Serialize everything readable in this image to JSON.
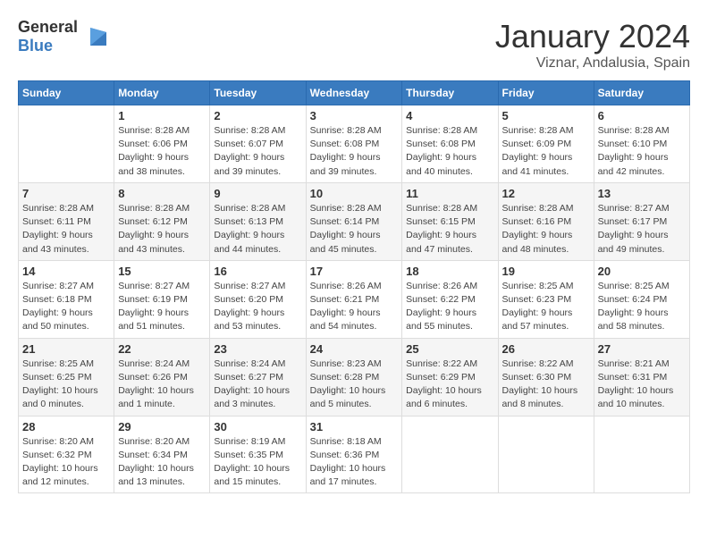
{
  "header": {
    "logo_general": "General",
    "logo_blue": "Blue",
    "month": "January 2024",
    "location": "Viznar, Andalusia, Spain"
  },
  "days_of_week": [
    "Sunday",
    "Monday",
    "Tuesday",
    "Wednesday",
    "Thursday",
    "Friday",
    "Saturday"
  ],
  "weeks": [
    [
      {
        "day": "",
        "info": ""
      },
      {
        "day": "1",
        "info": "Sunrise: 8:28 AM\nSunset: 6:06 PM\nDaylight: 9 hours\nand 38 minutes."
      },
      {
        "day": "2",
        "info": "Sunrise: 8:28 AM\nSunset: 6:07 PM\nDaylight: 9 hours\nand 39 minutes."
      },
      {
        "day": "3",
        "info": "Sunrise: 8:28 AM\nSunset: 6:08 PM\nDaylight: 9 hours\nand 39 minutes."
      },
      {
        "day": "4",
        "info": "Sunrise: 8:28 AM\nSunset: 6:08 PM\nDaylight: 9 hours\nand 40 minutes."
      },
      {
        "day": "5",
        "info": "Sunrise: 8:28 AM\nSunset: 6:09 PM\nDaylight: 9 hours\nand 41 minutes."
      },
      {
        "day": "6",
        "info": "Sunrise: 8:28 AM\nSunset: 6:10 PM\nDaylight: 9 hours\nand 42 minutes."
      }
    ],
    [
      {
        "day": "7",
        "info": "Sunrise: 8:28 AM\nSunset: 6:11 PM\nDaylight: 9 hours\nand 43 minutes."
      },
      {
        "day": "8",
        "info": "Sunrise: 8:28 AM\nSunset: 6:12 PM\nDaylight: 9 hours\nand 43 minutes."
      },
      {
        "day": "9",
        "info": "Sunrise: 8:28 AM\nSunset: 6:13 PM\nDaylight: 9 hours\nand 44 minutes."
      },
      {
        "day": "10",
        "info": "Sunrise: 8:28 AM\nSunset: 6:14 PM\nDaylight: 9 hours\nand 45 minutes."
      },
      {
        "day": "11",
        "info": "Sunrise: 8:28 AM\nSunset: 6:15 PM\nDaylight: 9 hours\nand 47 minutes."
      },
      {
        "day": "12",
        "info": "Sunrise: 8:28 AM\nSunset: 6:16 PM\nDaylight: 9 hours\nand 48 minutes."
      },
      {
        "day": "13",
        "info": "Sunrise: 8:27 AM\nSunset: 6:17 PM\nDaylight: 9 hours\nand 49 minutes."
      }
    ],
    [
      {
        "day": "14",
        "info": "Sunrise: 8:27 AM\nSunset: 6:18 PM\nDaylight: 9 hours\nand 50 minutes."
      },
      {
        "day": "15",
        "info": "Sunrise: 8:27 AM\nSunset: 6:19 PM\nDaylight: 9 hours\nand 51 minutes."
      },
      {
        "day": "16",
        "info": "Sunrise: 8:27 AM\nSunset: 6:20 PM\nDaylight: 9 hours\nand 53 minutes."
      },
      {
        "day": "17",
        "info": "Sunrise: 8:26 AM\nSunset: 6:21 PM\nDaylight: 9 hours\nand 54 minutes."
      },
      {
        "day": "18",
        "info": "Sunrise: 8:26 AM\nSunset: 6:22 PM\nDaylight: 9 hours\nand 55 minutes."
      },
      {
        "day": "19",
        "info": "Sunrise: 8:25 AM\nSunset: 6:23 PM\nDaylight: 9 hours\nand 57 minutes."
      },
      {
        "day": "20",
        "info": "Sunrise: 8:25 AM\nSunset: 6:24 PM\nDaylight: 9 hours\nand 58 minutes."
      }
    ],
    [
      {
        "day": "21",
        "info": "Sunrise: 8:25 AM\nSunset: 6:25 PM\nDaylight: 10 hours\nand 0 minutes."
      },
      {
        "day": "22",
        "info": "Sunrise: 8:24 AM\nSunset: 6:26 PM\nDaylight: 10 hours\nand 1 minute."
      },
      {
        "day": "23",
        "info": "Sunrise: 8:24 AM\nSunset: 6:27 PM\nDaylight: 10 hours\nand 3 minutes."
      },
      {
        "day": "24",
        "info": "Sunrise: 8:23 AM\nSunset: 6:28 PM\nDaylight: 10 hours\nand 5 minutes."
      },
      {
        "day": "25",
        "info": "Sunrise: 8:22 AM\nSunset: 6:29 PM\nDaylight: 10 hours\nand 6 minutes."
      },
      {
        "day": "26",
        "info": "Sunrise: 8:22 AM\nSunset: 6:30 PM\nDaylight: 10 hours\nand 8 minutes."
      },
      {
        "day": "27",
        "info": "Sunrise: 8:21 AM\nSunset: 6:31 PM\nDaylight: 10 hours\nand 10 minutes."
      }
    ],
    [
      {
        "day": "28",
        "info": "Sunrise: 8:20 AM\nSunset: 6:32 PM\nDaylight: 10 hours\nand 12 minutes."
      },
      {
        "day": "29",
        "info": "Sunrise: 8:20 AM\nSunset: 6:34 PM\nDaylight: 10 hours\nand 13 minutes."
      },
      {
        "day": "30",
        "info": "Sunrise: 8:19 AM\nSunset: 6:35 PM\nDaylight: 10 hours\nand 15 minutes."
      },
      {
        "day": "31",
        "info": "Sunrise: 8:18 AM\nSunset: 6:36 PM\nDaylight: 10 hours\nand 17 minutes."
      },
      {
        "day": "",
        "info": ""
      },
      {
        "day": "",
        "info": ""
      },
      {
        "day": "",
        "info": ""
      }
    ]
  ]
}
